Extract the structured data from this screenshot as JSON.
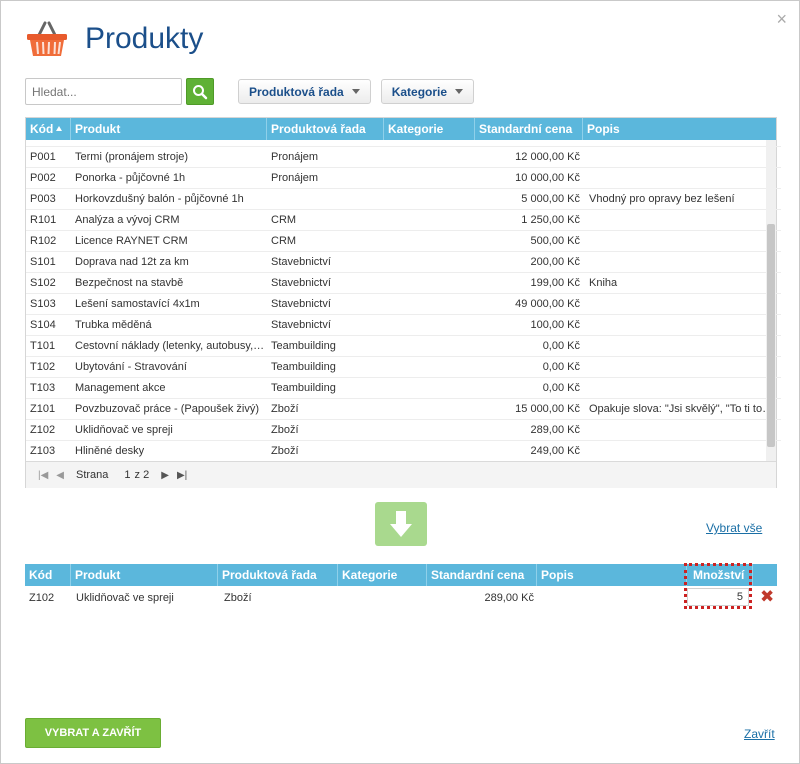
{
  "dialog": {
    "title": "Produkty",
    "close_symbol": "×",
    "logo_icon": "shopping-basket-icon"
  },
  "search": {
    "placeholder": "Hledat...",
    "value": ""
  },
  "filters": [
    {
      "label": "Produktová řada"
    },
    {
      "label": "Kategorie"
    }
  ],
  "top_grid": {
    "columns": [
      "Kód",
      "Produkt",
      "Produktová řada",
      "Kategorie",
      "Standardní cena",
      "Popis"
    ],
    "sort_column": "Kód",
    "rows": [
      {
        "kod": "P001",
        "produkt": "Termi (pronájem stroje)",
        "rada": "Pronájem",
        "kategorie": "",
        "cena": "12 000,00 Kč",
        "popis": ""
      },
      {
        "kod": "P002",
        "produkt": "Ponorka - půjčovné 1h",
        "rada": "Pronájem",
        "kategorie": "",
        "cena": "10 000,00 Kč",
        "popis": ""
      },
      {
        "kod": "P003",
        "produkt": "Horkovzdušný balón - půjčovné 1h",
        "rada": "",
        "kategorie": "",
        "cena": "5 000,00 Kč",
        "popis": "Vhodný pro opravy bez lešení"
      },
      {
        "kod": "R101",
        "produkt": "Analýza a vývoj CRM",
        "rada": "CRM",
        "kategorie": "",
        "cena": "1 250,00 Kč",
        "popis": ""
      },
      {
        "kod": "R102",
        "produkt": "Licence RAYNET CRM",
        "rada": "CRM",
        "kategorie": "",
        "cena": "500,00 Kč",
        "popis": ""
      },
      {
        "kod": "S101",
        "produkt": "Doprava nad 12t za km",
        "rada": "Stavebnictví",
        "kategorie": "",
        "cena": "200,00 Kč",
        "popis": ""
      },
      {
        "kod": "S102",
        "produkt": "Bezpečnost na stavbě",
        "rada": "Stavebnictví",
        "kategorie": "",
        "cena": "199,00 Kč",
        "popis": "Kniha"
      },
      {
        "kod": "S103",
        "produkt": "Lešení samostavící 4x1m",
        "rada": "Stavebnictví",
        "kategorie": "",
        "cena": "49 000,00 Kč",
        "popis": ""
      },
      {
        "kod": "S104",
        "produkt": "Trubka měděná",
        "rada": "Stavebnictví",
        "kategorie": "",
        "cena": "100,00 Kč",
        "popis": ""
      },
      {
        "kod": "T101",
        "produkt": "Cestovní náklady (letenky, autobusy, př...",
        "rada": "Teambuilding",
        "kategorie": "",
        "cena": "0,00 Kč",
        "popis": ""
      },
      {
        "kod": "T102",
        "produkt": "Ubytování - Stravování",
        "rada": "Teambuilding",
        "kategorie": "",
        "cena": "0,00 Kč",
        "popis": ""
      },
      {
        "kod": "T103",
        "produkt": "Management akce",
        "rada": "Teambuilding",
        "kategorie": "",
        "cena": "0,00 Kč",
        "popis": ""
      },
      {
        "kod": "Z101",
        "produkt": "Povzbuzovač práce - (Papoušek živý)",
        "rada": "Zboží",
        "kategorie": "",
        "cena": "15 000,00 Kč",
        "popis": "Opakuje slova: \"Jsi skvělý\", \"To ti to jde..."
      },
      {
        "kod": "Z102",
        "produkt": "Uklidňovač ve spreji",
        "rada": "Zboží",
        "kategorie": "",
        "cena": "289,00 Kč",
        "popis": ""
      },
      {
        "kod": "Z103",
        "produkt": "Hliněné desky",
        "rada": "Zboží",
        "kategorie": "",
        "cena": "249,00 Kč",
        "popis": ""
      }
    ]
  },
  "pager": {
    "label": "Strana",
    "current": "1",
    "of_text": "z 2"
  },
  "actions": {
    "select_all": "Vybrat vše",
    "submit": "VYBRAT A ZAVŘÍT",
    "close": "Zavřít",
    "move_down_icon": "arrow-down-icon"
  },
  "bottom_grid": {
    "columns": [
      "Kód",
      "Produkt",
      "Produktová řada",
      "Kategorie",
      "Standardní cena",
      "Popis",
      "Množství"
    ],
    "rows": [
      {
        "kod": "Z102",
        "produkt": "Uklidňovač ve spreji",
        "rada": "Zboží",
        "kategorie": "",
        "cena": "289,00 Kč",
        "popis": "",
        "mnozstvi": "5"
      }
    ],
    "remove_symbol": "✖"
  },
  "colors": {
    "header_blue": "#5bb7dc",
    "title_blue": "#1b4f8a",
    "green": "#7dc142",
    "highlight_red": "#cc2222"
  }
}
